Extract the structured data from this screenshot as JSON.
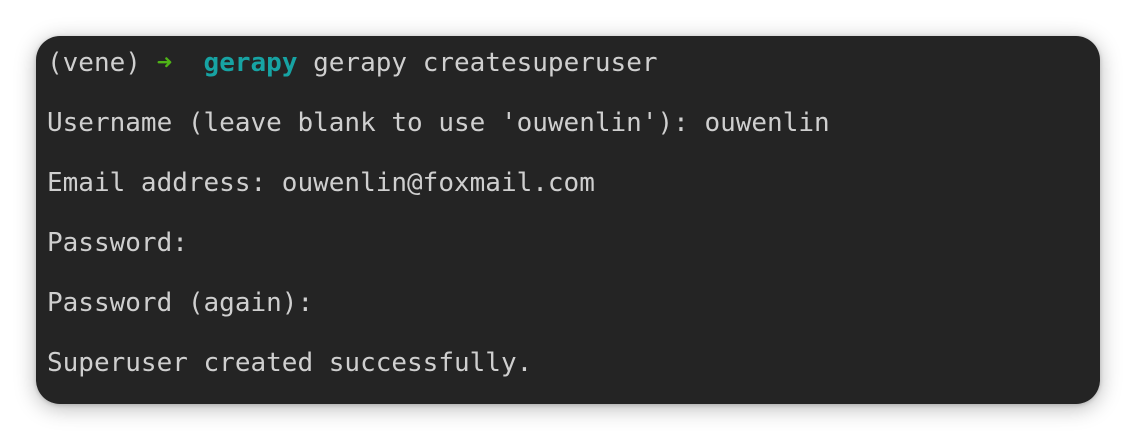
{
  "terminal": {
    "prompt": {
      "env": "(vene) ",
      "arrow_icon": "arrow-right-icon",
      "arrow_glyph": "➜",
      "cwd": "gerapy",
      "command": "gerapy createsuperuser"
    },
    "lines": [
      "Username (leave blank to use 'ouwenlin'): ouwenlin",
      "Email address: ouwenlin@foxmail.com",
      "Password:",
      "Password (again):",
      "Superuser created successfully."
    ]
  },
  "colors": {
    "background": "#242424",
    "text": "#cfcfcf",
    "arrow": "#4fb317",
    "cwd": "#17a3a3"
  }
}
